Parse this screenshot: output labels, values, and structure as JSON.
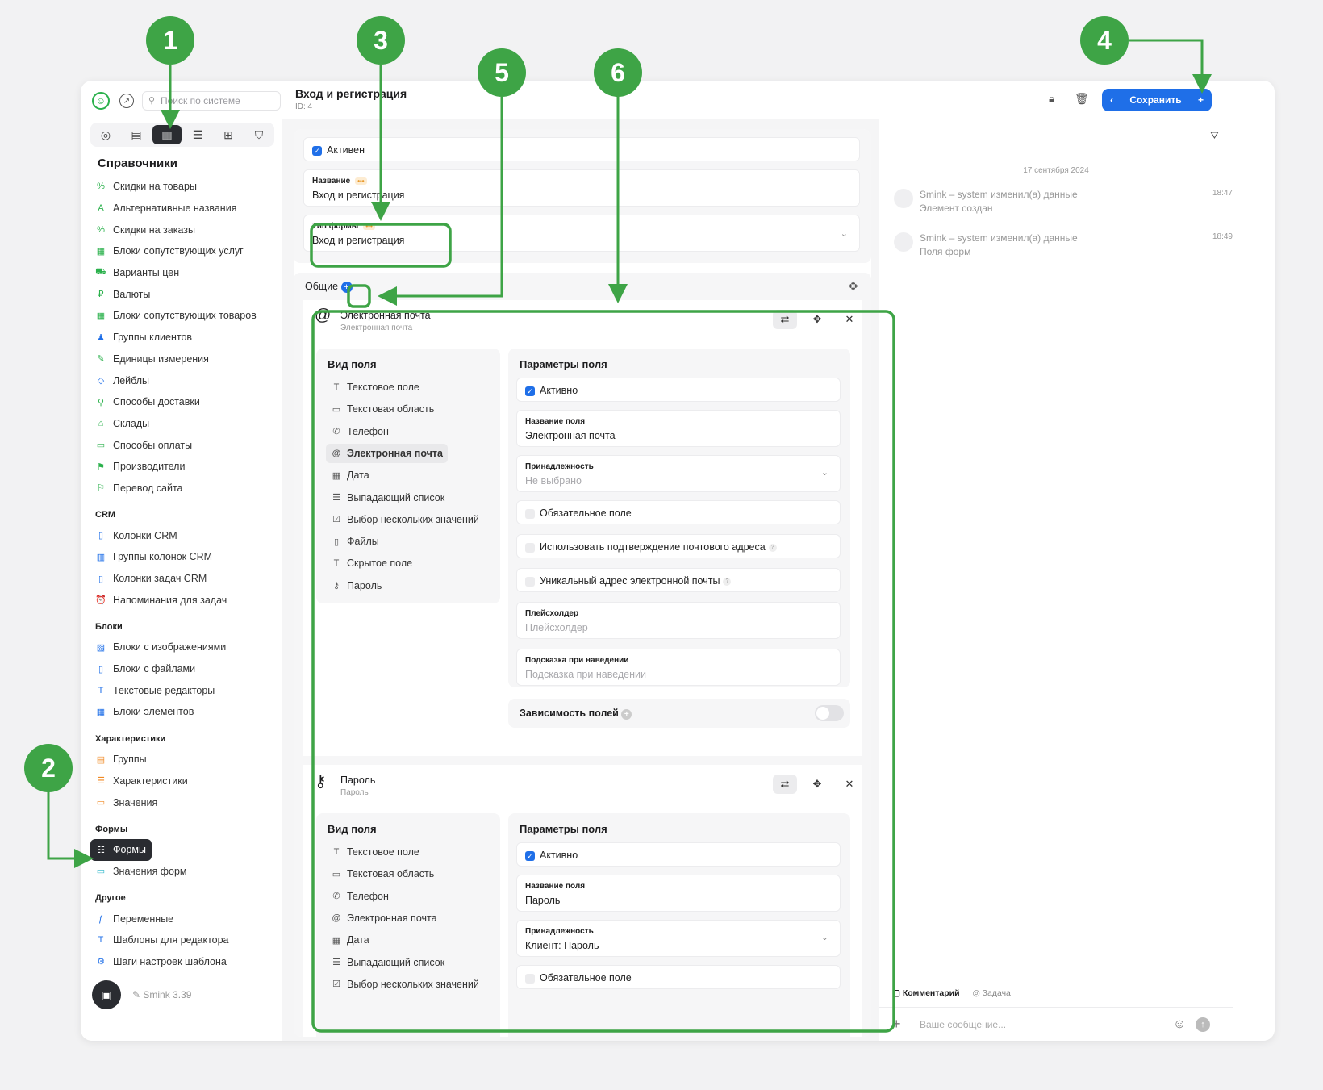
{
  "sidebar": {
    "search_placeholder": "Поиск по системе",
    "section_title": "Справочники",
    "groups": [
      {
        "title": "",
        "items": [
          {
            "label": "Скидки на товары",
            "icon": "percent-icon",
            "glyph": "%",
            "color": "#2bb14c"
          },
          {
            "label": "Альтернативные названия",
            "icon": "letter-a-icon",
            "glyph": "A",
            "color": "#2bb14c"
          },
          {
            "label": "Скидки на заказы",
            "icon": "percent-icon",
            "glyph": "%",
            "color": "#2bb14c"
          },
          {
            "label": "Блоки сопутствующих услуг",
            "icon": "grid-icon",
            "glyph": "▦",
            "color": "#2bb14c"
          },
          {
            "label": "Варианты цен",
            "icon": "cart-icon",
            "glyph": "⛟",
            "color": "#2bb14c"
          },
          {
            "label": "Валюты",
            "icon": "ruble-icon",
            "glyph": "₽",
            "color": "#2bb14c"
          },
          {
            "label": "Блоки сопутствующих товаров",
            "icon": "grid-icon",
            "glyph": "▦",
            "color": "#2bb14c"
          },
          {
            "label": "Группы клиентов",
            "icon": "users-icon",
            "glyph": "♟",
            "color": "#1f6fe8"
          },
          {
            "label": "Единицы измерения",
            "icon": "ruler-icon",
            "glyph": "✎",
            "color": "#2bb14c"
          },
          {
            "label": "Лейблы",
            "icon": "tag-icon",
            "glyph": "◇",
            "color": "#1f6fe8"
          },
          {
            "label": "Способы доставки",
            "icon": "walk-icon",
            "glyph": "⚲",
            "color": "#2bb14c"
          },
          {
            "label": "Склады",
            "icon": "warehouse-icon",
            "glyph": "⌂",
            "color": "#2bb14c"
          },
          {
            "label": "Способы оплаты",
            "icon": "card-icon",
            "glyph": "▭",
            "color": "#2bb14c"
          },
          {
            "label": "Производители",
            "icon": "factory-icon",
            "glyph": "⚑",
            "color": "#2bb14c"
          },
          {
            "label": "Перевод сайта",
            "icon": "flag-icon",
            "glyph": "⚐",
            "color": "#2bb14c"
          }
        ]
      },
      {
        "title": "CRM",
        "items": [
          {
            "label": "Колонки CRM",
            "icon": "column-icon",
            "glyph": "▯",
            "color": "#1f6fe8"
          },
          {
            "label": "Группы колонок CRM",
            "icon": "columns-icon",
            "glyph": "▥",
            "color": "#1f6fe8"
          },
          {
            "label": "Колонки задач CRM",
            "icon": "column-icon",
            "glyph": "▯",
            "color": "#1f6fe8"
          },
          {
            "label": "Напоминания для задач",
            "icon": "alarm-icon",
            "glyph": "⏰",
            "color": "#1f6fe8"
          }
        ]
      },
      {
        "title": "Блоки",
        "items": [
          {
            "label": "Блоки с изображениями",
            "icon": "image-icon",
            "glyph": "▨",
            "color": "#1f6fe8"
          },
          {
            "label": "Блоки с файлами",
            "icon": "file-icon",
            "glyph": "▯",
            "color": "#1f6fe8"
          },
          {
            "label": "Текстовые редакторы",
            "icon": "text-icon",
            "glyph": "T",
            "color": "#1f6fe8"
          },
          {
            "label": "Блоки элементов",
            "icon": "grid-icon",
            "glyph": "▦",
            "color": "#1f6fe8"
          }
        ]
      },
      {
        "title": "Характеристики",
        "items": [
          {
            "label": "Группы",
            "icon": "doc-icon",
            "glyph": "▤",
            "color": "#f08a24"
          },
          {
            "label": "Характеристики",
            "icon": "list-icon",
            "glyph": "☰",
            "color": "#f08a24"
          },
          {
            "label": "Значения",
            "icon": "tag-icon",
            "glyph": "▭",
            "color": "#f08a24"
          }
        ]
      },
      {
        "title": "Формы",
        "items": [
          {
            "label": "Формы",
            "icon": "form-icon",
            "glyph": "☷",
            "color": "#ffffff",
            "active": true
          },
          {
            "label": "Значения форм",
            "icon": "input-icon",
            "glyph": "▭",
            "color": "#26b5c9"
          }
        ]
      },
      {
        "title": "Другое",
        "items": [
          {
            "label": "Переменные",
            "icon": "function-icon",
            "glyph": "ƒ",
            "color": "#1f6fe8"
          },
          {
            "label": "Шаблоны для редактора",
            "icon": "text-icon",
            "glyph": "T",
            "color": "#1f6fe8"
          },
          {
            "label": "Шаги настроек шаблона",
            "icon": "steps-icon",
            "glyph": "⚙",
            "color": "#1f6fe8"
          }
        ]
      }
    ],
    "version": "Smink 3.39"
  },
  "header": {
    "title": "Вход и регистрация",
    "id_label": "ID: 4",
    "save_label": "Сохранить"
  },
  "form": {
    "active_label": "Активен",
    "name_label": "Название",
    "name_value": "Вход и регистрация",
    "type_label": "Тип формы",
    "type_value": "Вход и регистрация",
    "group_label": "Общие"
  },
  "field_types_title": "Вид поля",
  "field_types": [
    {
      "label": "Текстовое поле",
      "glyph": "T"
    },
    {
      "label": "Текстовая область",
      "glyph": "▭"
    },
    {
      "label": "Телефон",
      "glyph": "✆"
    },
    {
      "label": "Электронная почта",
      "glyph": "@"
    },
    {
      "label": "Дата",
      "glyph": "▦"
    },
    {
      "label": "Выпадающий список",
      "glyph": "☰"
    },
    {
      "label": "Выбор нескольких значений",
      "glyph": "☑"
    },
    {
      "label": "Файлы",
      "glyph": "▯"
    },
    {
      "label": "Скрытое поле",
      "glyph": "T"
    },
    {
      "label": "Пароль",
      "glyph": "⚷"
    }
  ],
  "params_title": "Параметры поля",
  "blocks": [
    {
      "title": "Электронная почта",
      "subtitle": "Электронная почта",
      "selected_type": 3,
      "active_label": "Активно",
      "name_label": "Название поля",
      "name_value": "Электронная почта",
      "belong_label": "Принадлежность",
      "belong_value": "Не выбрано",
      "required_label": "Обязательное поле",
      "confirm_label": "Использовать подтверждение почтового адреса",
      "unique_label": "Уникальный адрес электронной почты",
      "placeholder_label": "Плейсхолдер",
      "placeholder_value": "Плейсхолдер",
      "hint_label": "Подсказка при наведении",
      "hint_value": "Подсказка при наведении",
      "dependency_label": "Зависимость полей"
    },
    {
      "title": "Пароль",
      "subtitle": "Пароль",
      "selected_type": 9,
      "active_label": "Активно",
      "name_label": "Название поля",
      "name_value": "Пароль",
      "belong_label": "Принадлежность",
      "belong_value": "Клиент: Пароль",
      "required_label": "Обязательное поле"
    }
  ],
  "history": {
    "date": "17 сентября 2024",
    "entries": [
      {
        "line1": "Smink – system изменил(а) данные",
        "line2": "Элемент создан",
        "time": "18:47"
      },
      {
        "line1": "Smink – system изменил(а) данные",
        "line2": "Поля форм",
        "time": "18:49"
      }
    ],
    "tab_comment": "Комментарий",
    "tab_task": "Задача",
    "message_placeholder": "Ваше сообщение..."
  },
  "annotations": [
    "1",
    "2",
    "3",
    "4",
    "5",
    "6"
  ],
  "colors": {
    "accent": "#1f6fe8",
    "annotation": "#3ea446",
    "dark": "#2a2c31"
  }
}
